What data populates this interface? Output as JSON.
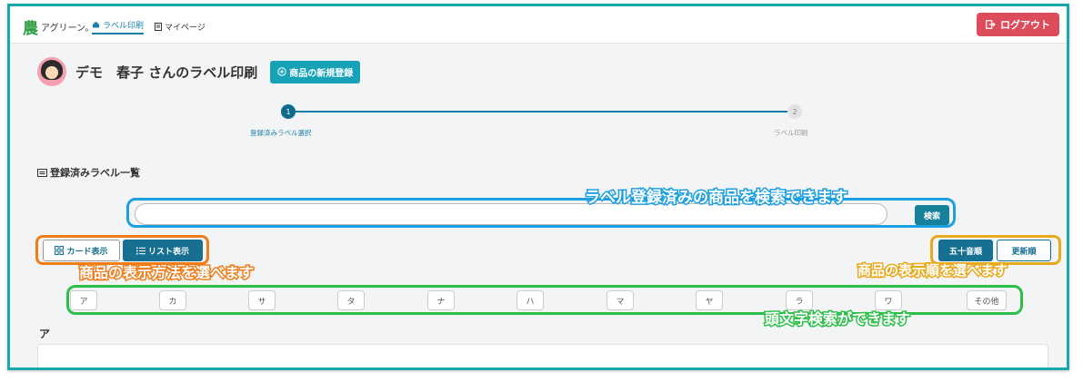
{
  "topbar": {
    "logo_glyph": "農",
    "logo_text": "アグリーン。",
    "nav": [
      {
        "label": "ラベル印刷",
        "active": true,
        "icon": "printer-icon"
      },
      {
        "label": "マイページ",
        "active": false,
        "icon": "page-icon"
      }
    ],
    "logout_label": "ログアウト"
  },
  "header": {
    "title": "デモ　春子 さんのラベル印刷",
    "new_product_label": "商品の新規登録"
  },
  "stepper": {
    "steps": [
      {
        "number": "1",
        "label": "登録済みラベル選択"
      },
      {
        "number": "2",
        "label": "ラベル印刷"
      }
    ]
  },
  "section": {
    "title": "登録済みラベル一覧"
  },
  "search": {
    "placeholder": "",
    "button_label": "検索",
    "callout": "ラベル登録済みの商品を検索できます"
  },
  "view_toggle": {
    "card_label": "カード表示",
    "list_label": "リスト表示",
    "callout": "商品の表示方法を選べます"
  },
  "sort": {
    "alpha_label": "五十音順",
    "updated_label": "更新順",
    "callout": "商品の表示順を選べます"
  },
  "initials": {
    "buttons": [
      "ア",
      "カ",
      "サ",
      "タ",
      "ナ",
      "ハ",
      "マ",
      "ヤ",
      "ラ",
      "ワ",
      "その他"
    ],
    "callout": "頭文字検索ができます"
  },
  "list": {
    "group_heading": "ア"
  },
  "colors": {
    "accent": "#17a2b8",
    "primary_dark": "#176f92",
    "logout": "#dc4c5a",
    "frame": "#1aa8ac",
    "callout_search": "#1e9fe0",
    "callout_view": "#f07d1a",
    "callout_sort": "#e8a91c",
    "callout_initials": "#2ebf4a"
  }
}
